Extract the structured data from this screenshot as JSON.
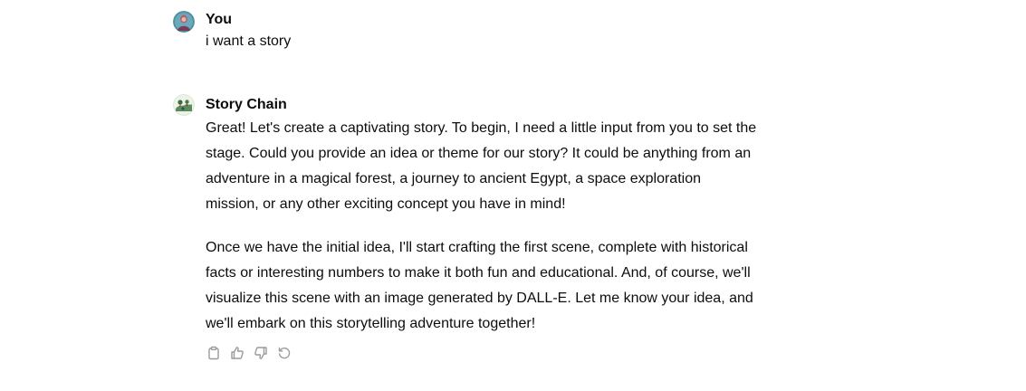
{
  "conversation": {
    "user_message": {
      "sender": "You",
      "text": "i want a story"
    },
    "assistant_message": {
      "sender": "Story Chain",
      "paragraphs": [
        "Great! Let's create a captivating story. To begin, I need a little input from you to set the stage. Could you provide an idea or theme for our story? It could be anything from an adventure in a magical forest, a journey to ancient Egypt, a space exploration mission, or any other exciting concept you have in mind!",
        "Once we have the initial idea, I'll start crafting the first scene, complete with historical facts or interesting numbers to make it both fun and educational. And, of course, we'll visualize this scene with an image generated by DALL-E. Let me know your idea, and we'll embark on this storytelling adventure together!"
      ],
      "actions": [
        "copy-icon",
        "thumbs-up-icon",
        "thumbs-down-icon",
        "regenerate-icon"
      ]
    }
  },
  "colors": {
    "text": "#0d0d0d",
    "icon": "#9b9b9b",
    "background": "#ffffff"
  }
}
